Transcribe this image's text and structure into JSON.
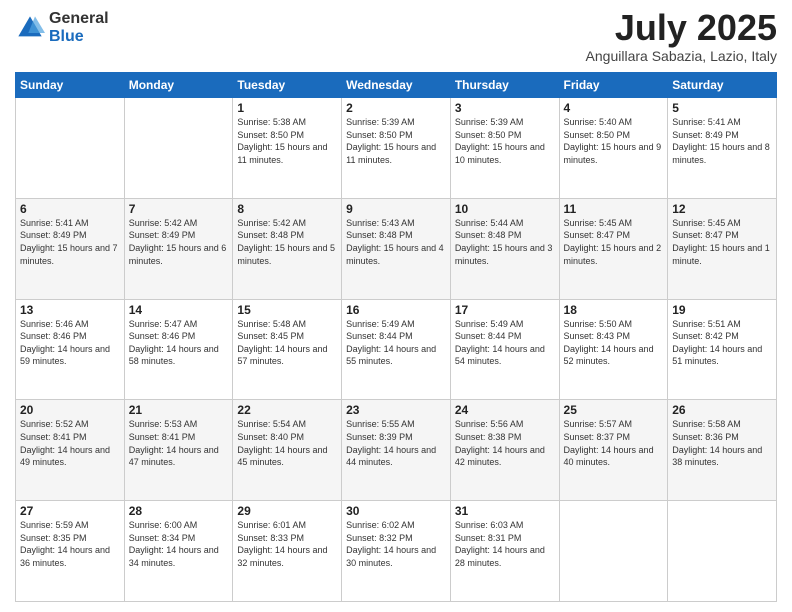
{
  "logo": {
    "general": "General",
    "blue": "Blue"
  },
  "header": {
    "month": "July 2025",
    "location": "Anguillara Sabazia, Lazio, Italy"
  },
  "weekdays": [
    "Sunday",
    "Monday",
    "Tuesday",
    "Wednesday",
    "Thursday",
    "Friday",
    "Saturday"
  ],
  "weeks": [
    [
      {
        "day": "",
        "sunrise": "",
        "sunset": "",
        "daylight": ""
      },
      {
        "day": "",
        "sunrise": "",
        "sunset": "",
        "daylight": ""
      },
      {
        "day": "1",
        "sunrise": "Sunrise: 5:38 AM",
        "sunset": "Sunset: 8:50 PM",
        "daylight": "Daylight: 15 hours and 11 minutes."
      },
      {
        "day": "2",
        "sunrise": "Sunrise: 5:39 AM",
        "sunset": "Sunset: 8:50 PM",
        "daylight": "Daylight: 15 hours and 11 minutes."
      },
      {
        "day": "3",
        "sunrise": "Sunrise: 5:39 AM",
        "sunset": "Sunset: 8:50 PM",
        "daylight": "Daylight: 15 hours and 10 minutes."
      },
      {
        "day": "4",
        "sunrise": "Sunrise: 5:40 AM",
        "sunset": "Sunset: 8:50 PM",
        "daylight": "Daylight: 15 hours and 9 minutes."
      },
      {
        "day": "5",
        "sunrise": "Sunrise: 5:41 AM",
        "sunset": "Sunset: 8:49 PM",
        "daylight": "Daylight: 15 hours and 8 minutes."
      }
    ],
    [
      {
        "day": "6",
        "sunrise": "Sunrise: 5:41 AM",
        "sunset": "Sunset: 8:49 PM",
        "daylight": "Daylight: 15 hours and 7 minutes."
      },
      {
        "day": "7",
        "sunrise": "Sunrise: 5:42 AM",
        "sunset": "Sunset: 8:49 PM",
        "daylight": "Daylight: 15 hours and 6 minutes."
      },
      {
        "day": "8",
        "sunrise": "Sunrise: 5:42 AM",
        "sunset": "Sunset: 8:48 PM",
        "daylight": "Daylight: 15 hours and 5 minutes."
      },
      {
        "day": "9",
        "sunrise": "Sunrise: 5:43 AM",
        "sunset": "Sunset: 8:48 PM",
        "daylight": "Daylight: 15 hours and 4 minutes."
      },
      {
        "day": "10",
        "sunrise": "Sunrise: 5:44 AM",
        "sunset": "Sunset: 8:48 PM",
        "daylight": "Daylight: 15 hours and 3 minutes."
      },
      {
        "day": "11",
        "sunrise": "Sunrise: 5:45 AM",
        "sunset": "Sunset: 8:47 PM",
        "daylight": "Daylight: 15 hours and 2 minutes."
      },
      {
        "day": "12",
        "sunrise": "Sunrise: 5:45 AM",
        "sunset": "Sunset: 8:47 PM",
        "daylight": "Daylight: 15 hours and 1 minute."
      }
    ],
    [
      {
        "day": "13",
        "sunrise": "Sunrise: 5:46 AM",
        "sunset": "Sunset: 8:46 PM",
        "daylight": "Daylight: 14 hours and 59 minutes."
      },
      {
        "day": "14",
        "sunrise": "Sunrise: 5:47 AM",
        "sunset": "Sunset: 8:46 PM",
        "daylight": "Daylight: 14 hours and 58 minutes."
      },
      {
        "day": "15",
        "sunrise": "Sunrise: 5:48 AM",
        "sunset": "Sunset: 8:45 PM",
        "daylight": "Daylight: 14 hours and 57 minutes."
      },
      {
        "day": "16",
        "sunrise": "Sunrise: 5:49 AM",
        "sunset": "Sunset: 8:44 PM",
        "daylight": "Daylight: 14 hours and 55 minutes."
      },
      {
        "day": "17",
        "sunrise": "Sunrise: 5:49 AM",
        "sunset": "Sunset: 8:44 PM",
        "daylight": "Daylight: 14 hours and 54 minutes."
      },
      {
        "day": "18",
        "sunrise": "Sunrise: 5:50 AM",
        "sunset": "Sunset: 8:43 PM",
        "daylight": "Daylight: 14 hours and 52 minutes."
      },
      {
        "day": "19",
        "sunrise": "Sunrise: 5:51 AM",
        "sunset": "Sunset: 8:42 PM",
        "daylight": "Daylight: 14 hours and 51 minutes."
      }
    ],
    [
      {
        "day": "20",
        "sunrise": "Sunrise: 5:52 AM",
        "sunset": "Sunset: 8:41 PM",
        "daylight": "Daylight: 14 hours and 49 minutes."
      },
      {
        "day": "21",
        "sunrise": "Sunrise: 5:53 AM",
        "sunset": "Sunset: 8:41 PM",
        "daylight": "Daylight: 14 hours and 47 minutes."
      },
      {
        "day": "22",
        "sunrise": "Sunrise: 5:54 AM",
        "sunset": "Sunset: 8:40 PM",
        "daylight": "Daylight: 14 hours and 45 minutes."
      },
      {
        "day": "23",
        "sunrise": "Sunrise: 5:55 AM",
        "sunset": "Sunset: 8:39 PM",
        "daylight": "Daylight: 14 hours and 44 minutes."
      },
      {
        "day": "24",
        "sunrise": "Sunrise: 5:56 AM",
        "sunset": "Sunset: 8:38 PM",
        "daylight": "Daylight: 14 hours and 42 minutes."
      },
      {
        "day": "25",
        "sunrise": "Sunrise: 5:57 AM",
        "sunset": "Sunset: 8:37 PM",
        "daylight": "Daylight: 14 hours and 40 minutes."
      },
      {
        "day": "26",
        "sunrise": "Sunrise: 5:58 AM",
        "sunset": "Sunset: 8:36 PM",
        "daylight": "Daylight: 14 hours and 38 minutes."
      }
    ],
    [
      {
        "day": "27",
        "sunrise": "Sunrise: 5:59 AM",
        "sunset": "Sunset: 8:35 PM",
        "daylight": "Daylight: 14 hours and 36 minutes."
      },
      {
        "day": "28",
        "sunrise": "Sunrise: 6:00 AM",
        "sunset": "Sunset: 8:34 PM",
        "daylight": "Daylight: 14 hours and 34 minutes."
      },
      {
        "day": "29",
        "sunrise": "Sunrise: 6:01 AM",
        "sunset": "Sunset: 8:33 PM",
        "daylight": "Daylight: 14 hours and 32 minutes."
      },
      {
        "day": "30",
        "sunrise": "Sunrise: 6:02 AM",
        "sunset": "Sunset: 8:32 PM",
        "daylight": "Daylight: 14 hours and 30 minutes."
      },
      {
        "day": "31",
        "sunrise": "Sunrise: 6:03 AM",
        "sunset": "Sunset: 8:31 PM",
        "daylight": "Daylight: 14 hours and 28 minutes."
      },
      {
        "day": "",
        "sunrise": "",
        "sunset": "",
        "daylight": ""
      },
      {
        "day": "",
        "sunrise": "",
        "sunset": "",
        "daylight": ""
      }
    ]
  ]
}
